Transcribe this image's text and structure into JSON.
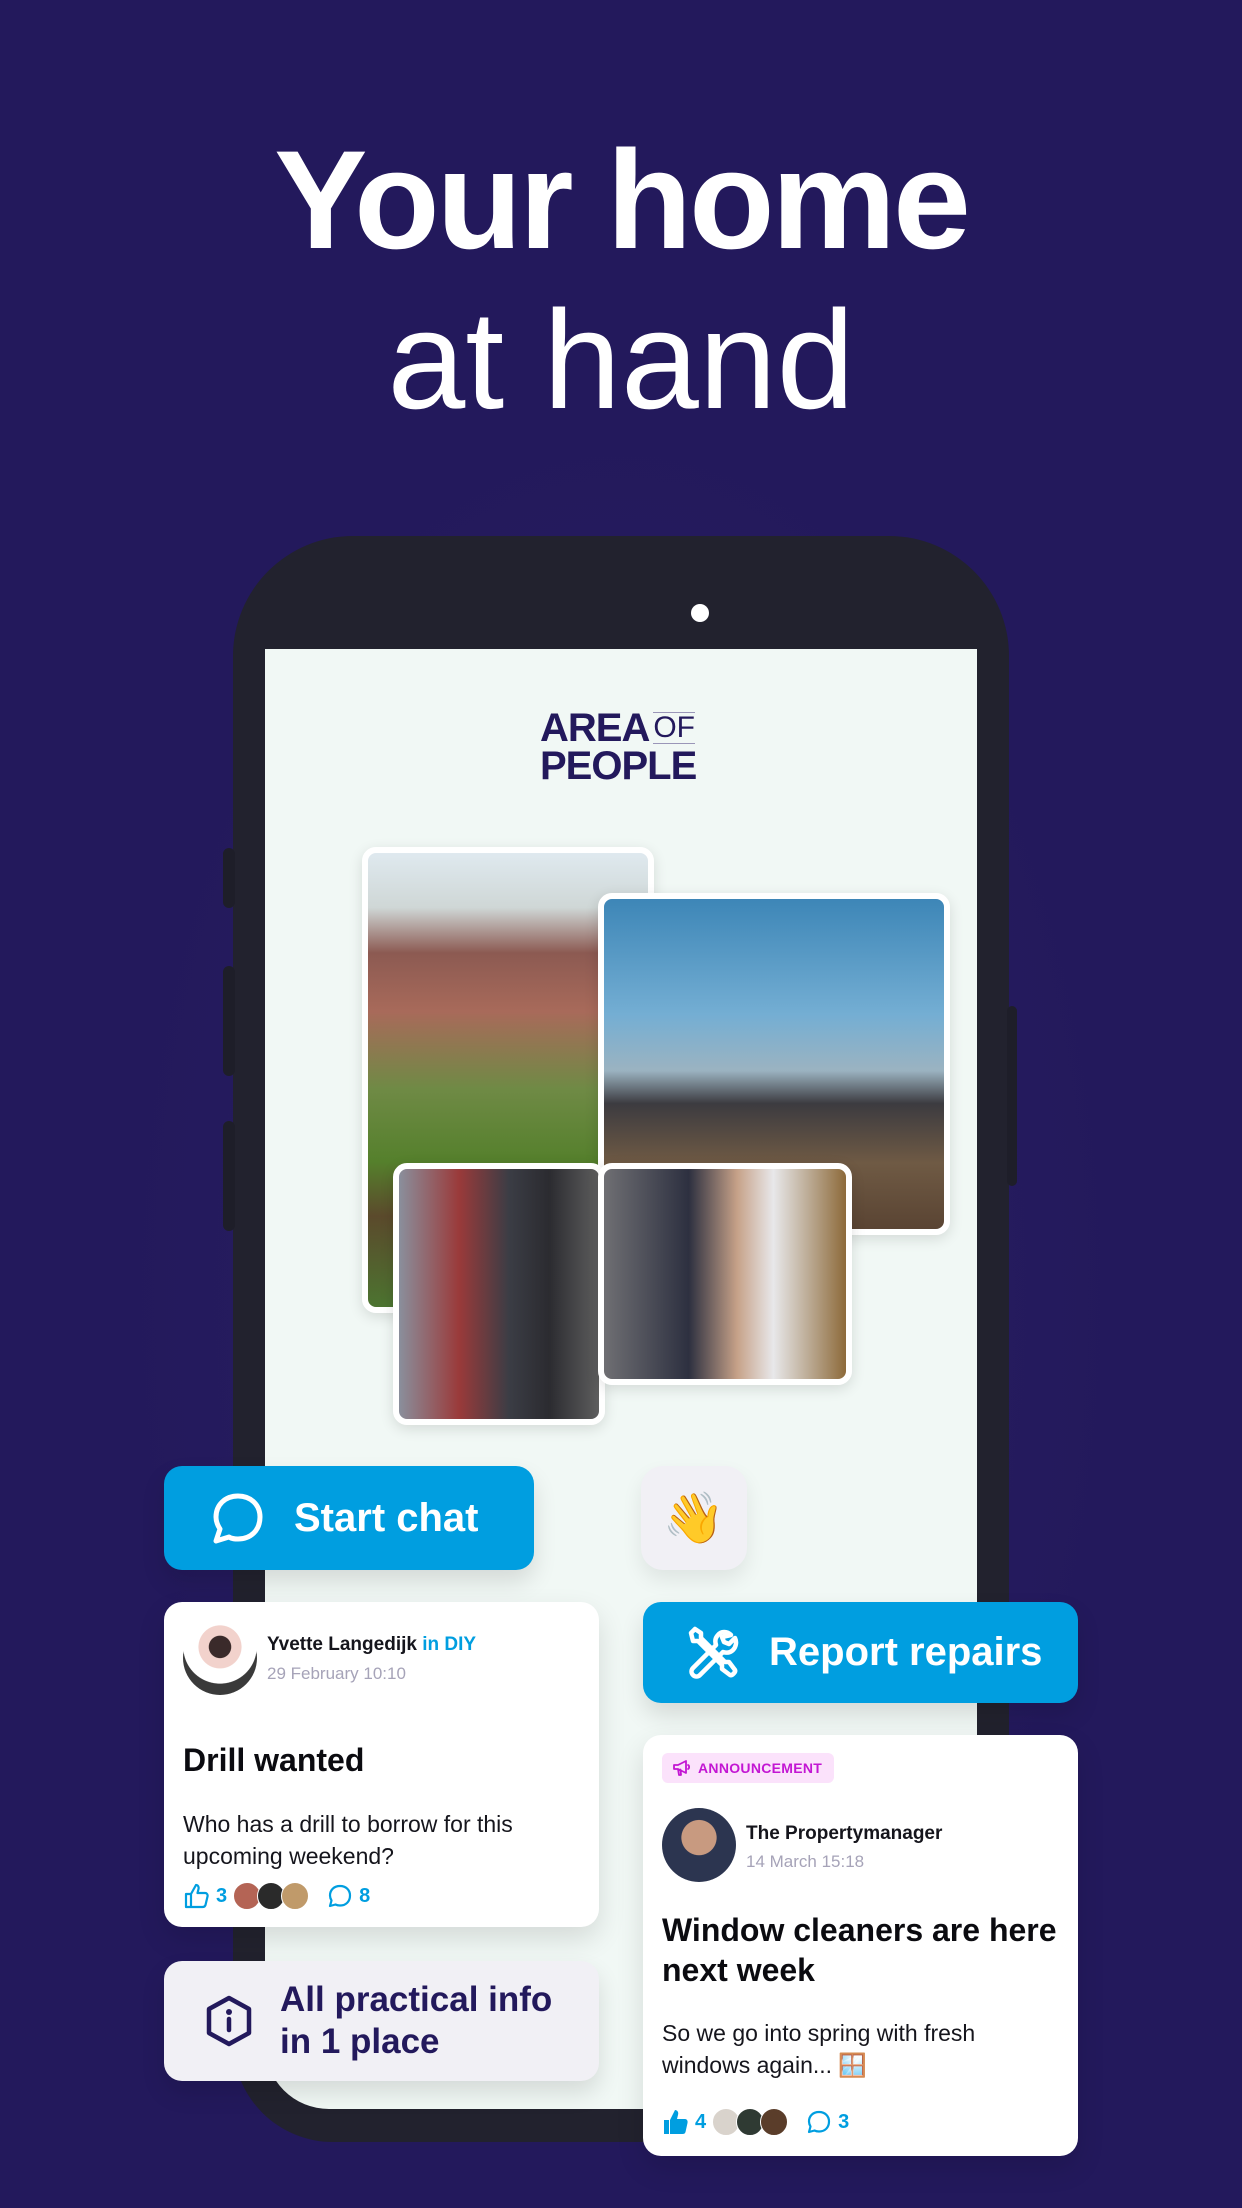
{
  "headline": {
    "line1": "Your home",
    "line2": "at hand"
  },
  "app": {
    "logo": {
      "word1": "AREA",
      "word2": "OF",
      "word3": "PEOPLE"
    },
    "photos": [
      {
        "name": "community-garden-photo",
        "description": "Neighbours gardening in front of houses"
      },
      {
        "name": "construction-groundbreaking-photo",
        "description": "Group digging at building site"
      },
      {
        "name": "neighbours-carrying-boxes-photo",
        "description": "Two men carrying boxes"
      },
      {
        "name": "neighbours-smartphone-photo",
        "description": "Young man and elderly woman looking at phone"
      }
    ]
  },
  "actions": {
    "start_chat": {
      "label": "Start chat",
      "icon": "chat-bubble-icon"
    },
    "wave": {
      "emoji": "👋",
      "icon": "waving-hand-icon"
    },
    "report_repairs": {
      "label": "Report repairs",
      "icon": "tools-icon"
    },
    "practical_info": {
      "label_line1": "All practical info",
      "label_line2": "in 1 place",
      "icon": "info-hexagon-icon"
    }
  },
  "posts": [
    {
      "author": "Yvette Langedijk",
      "category_prefix": "in",
      "category": "DIY",
      "date": "29 February 10:10",
      "title": "Drill wanted",
      "body": "Who has a drill to borrow for this upcoming weekend?",
      "likes": "3",
      "comments": "8",
      "liked": false
    },
    {
      "badge": "ANNOUNCEMENT",
      "author": "The Propertymanager",
      "date": "14 March 15:18",
      "title": "Window cleaners are here  next week",
      "body": "So we go into spring with fresh windows again... 🪟",
      "likes": "4",
      "comments": "3",
      "liked": true
    }
  ],
  "colors": {
    "background": "#23195c",
    "accent_blue": "#009ee0",
    "brand_purple": "#23195c",
    "announcement": "#c316d3"
  }
}
